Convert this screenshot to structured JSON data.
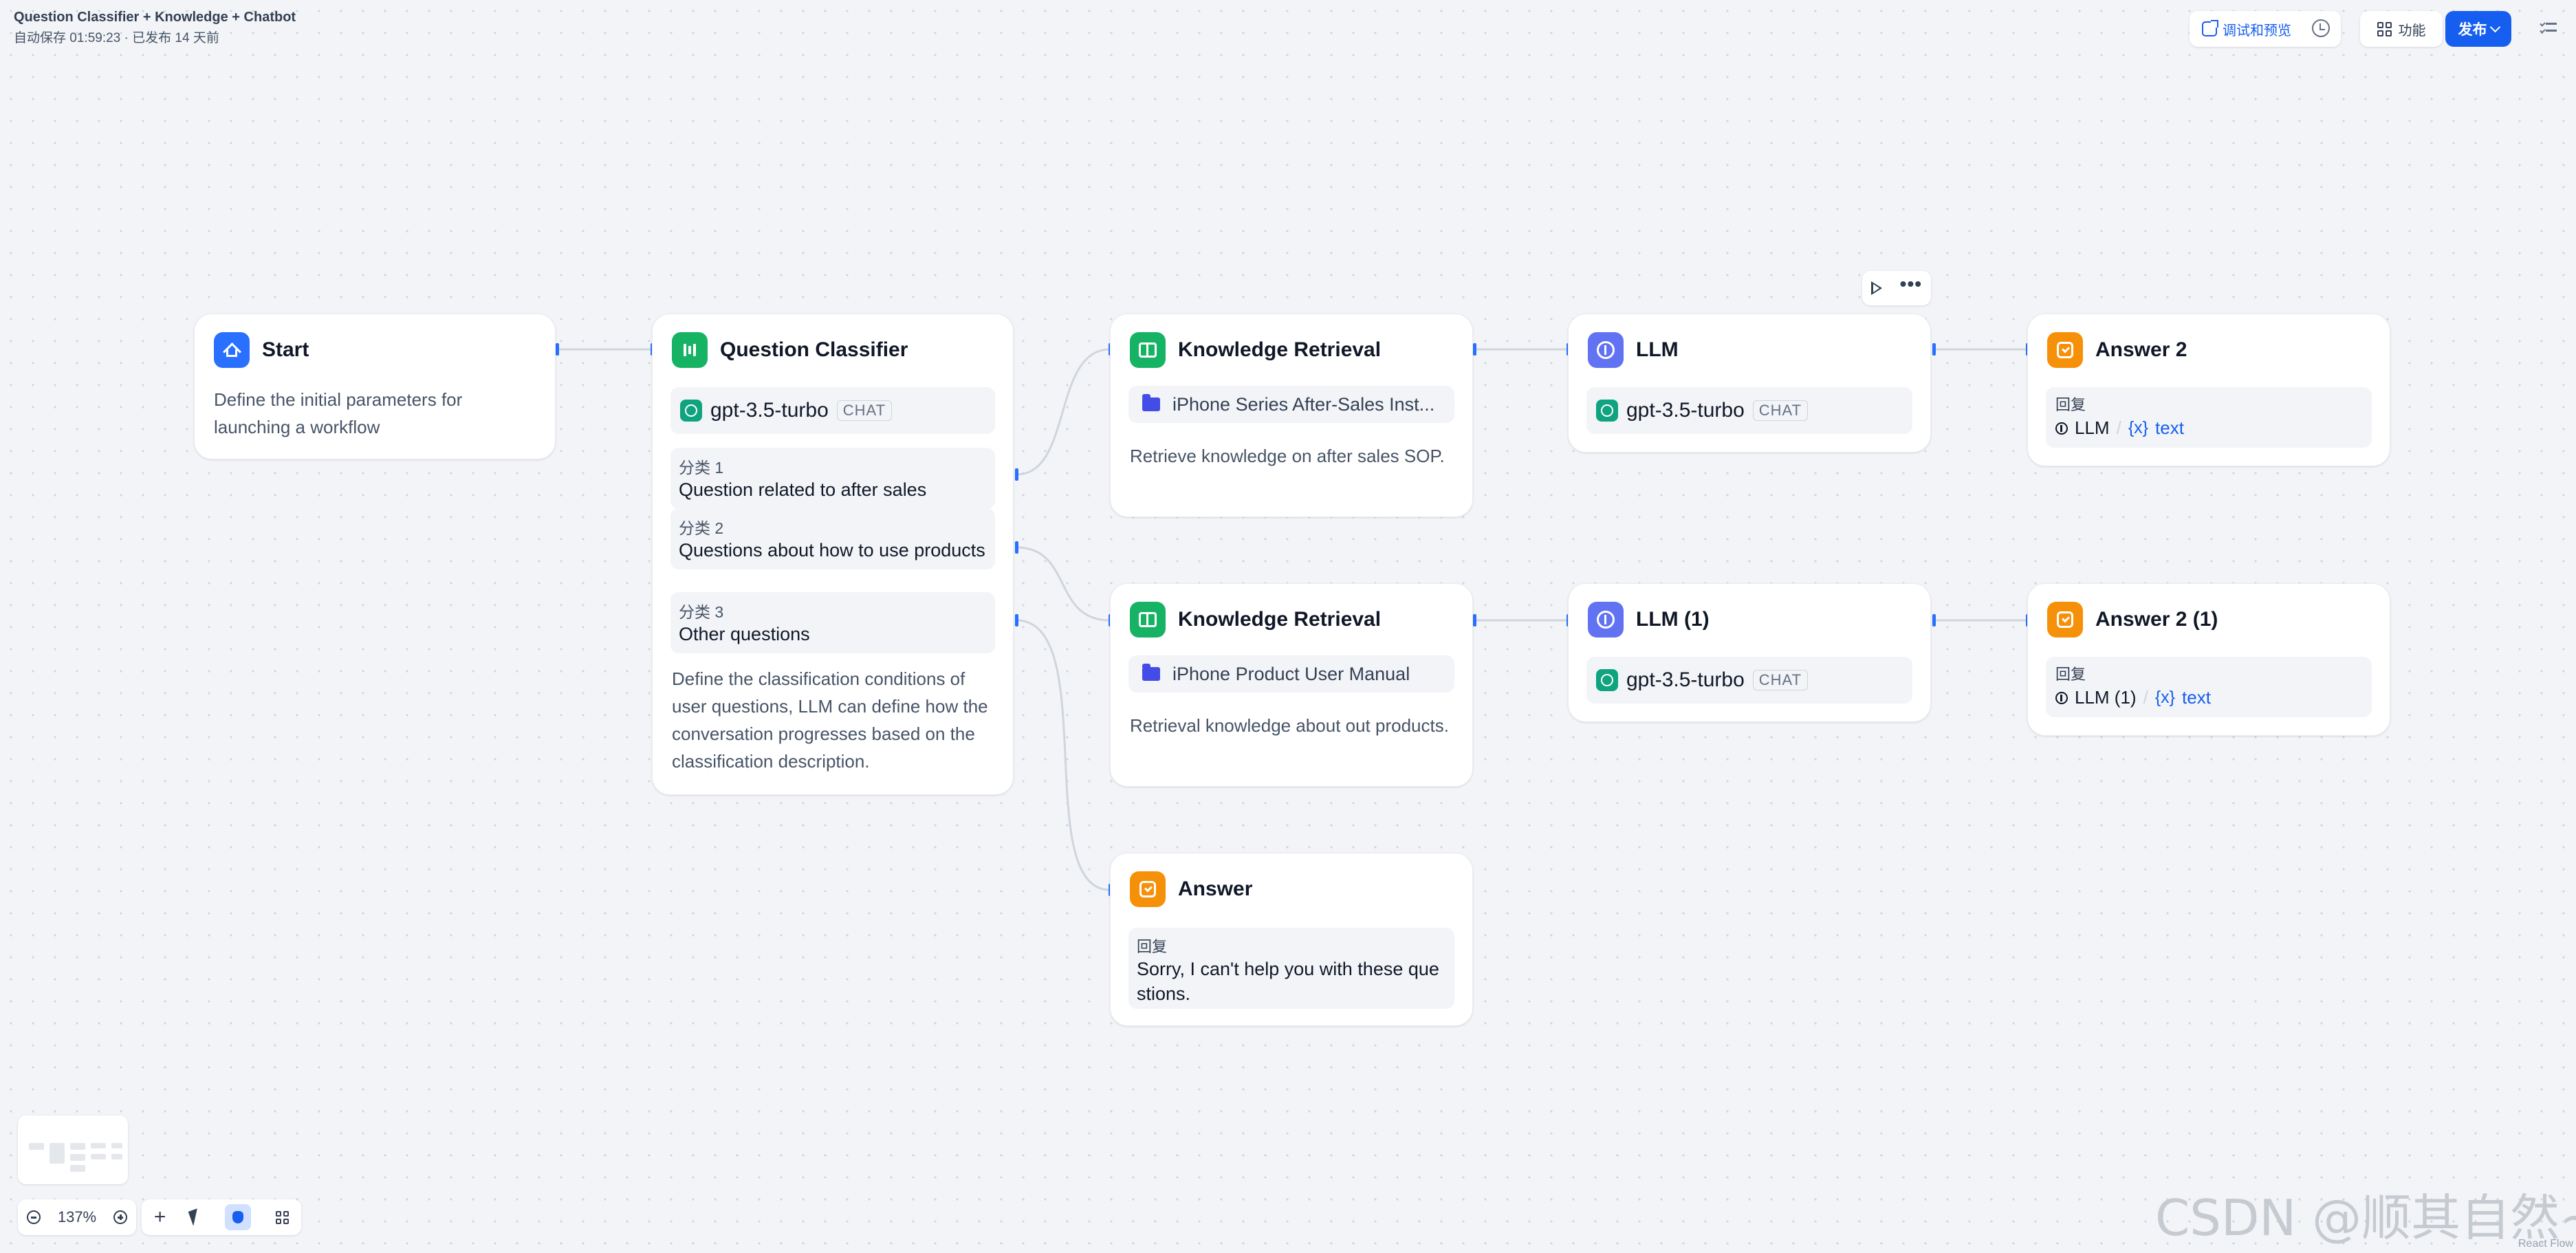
{
  "header": {
    "app_title": "Question Classifier + Knowledge + Chatbot",
    "status": "自动保存 01:59:23 · 已发布 14 天前",
    "debug_label": "调试和预览",
    "feature_label": "功能",
    "publish_label": "发布"
  },
  "nodes": {
    "start": {
      "title": "Start",
      "desc": "Define the initial parameters for launching a workflow"
    },
    "classifier": {
      "title": "Question Classifier",
      "model": "gpt-3.5-turbo",
      "model_tag": "CHAT",
      "classes": [
        {
          "label": "分类 1",
          "text": "Question related to after sales"
        },
        {
          "label": "分类 2",
          "text": "Questions about how to use products"
        },
        {
          "label": "分类 3",
          "text": "Other questions"
        }
      ],
      "desc": "Define the classification conditions of user questions, LLM can define how the conversation progresses based on the classification description."
    },
    "kr1": {
      "title": "Knowledge Retrieval",
      "dataset": "iPhone Series After-Sales Inst...",
      "desc": "Retrieve knowledge on after sales SOP."
    },
    "kr2": {
      "title": "Knowledge Retrieval",
      "dataset": "iPhone Product User Manual",
      "desc": "Retrieval knowledge about out products."
    },
    "answer": {
      "title": "Answer",
      "reply_label": "回复",
      "reply_text": "Sorry, I can't help you with these questions."
    },
    "llm": {
      "title": "LLM",
      "model": "gpt-3.5-turbo",
      "model_tag": "CHAT"
    },
    "llm1": {
      "title": "LLM (1)",
      "model": "gpt-3.5-turbo",
      "model_tag": "CHAT"
    },
    "answer2": {
      "title": "Answer 2",
      "reply_label": "回复",
      "var_node": "LLM",
      "var_icon": "{x}",
      "var_name": "text",
      "sep": "/"
    },
    "answer2_1": {
      "title": "Answer 2 (1)",
      "reply_label": "回复",
      "var_node": "LLM (1)",
      "var_icon": "{x}",
      "var_name": "text",
      "sep": "/"
    }
  },
  "controls": {
    "zoom": "137%",
    "more": "•••",
    "plus": "+"
  },
  "watermark": "CSDN @顺其自然~",
  "react_flow": "React Flow",
  "colors": {
    "accent": "#155eef",
    "start": "#2970ff",
    "green": "#16b364",
    "indigo": "#6172f3",
    "orange": "#f79009"
  }
}
